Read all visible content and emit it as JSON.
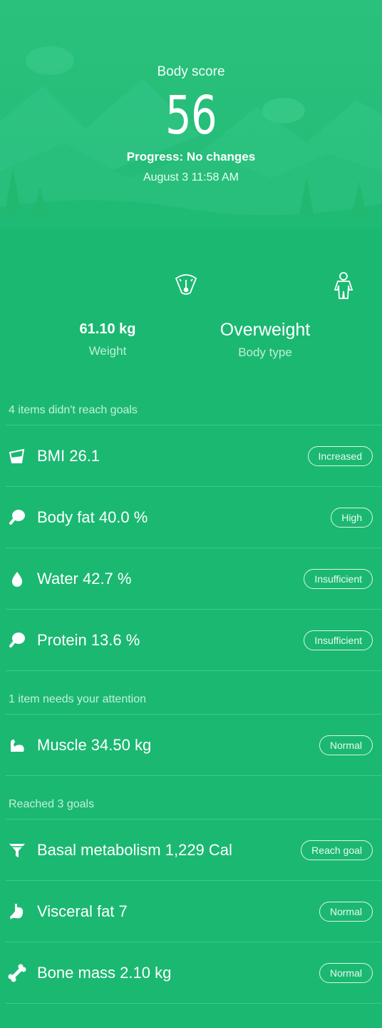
{
  "header": {
    "score_label": "Body score",
    "score_value": "56",
    "progress": "Progress: No changes",
    "date": "August 3 11:58 AM"
  },
  "stats": {
    "weight": {
      "value": "61.10 kg",
      "label": "Weight",
      "icon": "scale-icon"
    },
    "body_type": {
      "value": "Overweight",
      "label": "Body type",
      "icon": "person-icon"
    }
  },
  "sections": [
    {
      "title": "4 items didn't reach goals",
      "items": [
        {
          "label": "BMI 26.1",
          "badge": "Increased",
          "icon": "bmi-icon"
        },
        {
          "label": "Body fat 40.0 %",
          "badge": "High",
          "icon": "drumstick-icon"
        },
        {
          "label": "Water 42.7 %",
          "badge": "Insufficient",
          "icon": "water-drop-icon"
        },
        {
          "label": "Protein 13.6 %",
          "badge": "Insufficient",
          "icon": "drumstick-icon"
        }
      ]
    },
    {
      "title": "1 item needs your attention",
      "items": [
        {
          "label": "Muscle 34.50 kg",
          "badge": "Normal",
          "icon": "muscle-icon"
        }
      ]
    },
    {
      "title": "Reached 3 goals",
      "items": [
        {
          "label": "Basal metabolism 1,229 Cal",
          "badge": "Reach goal",
          "icon": "funnel-icon"
        },
        {
          "label": "Visceral fat 7",
          "badge": "Normal",
          "icon": "stomach-icon"
        },
        {
          "label": "Bone mass 2.10 kg",
          "badge": "Normal",
          "icon": "bone-icon"
        }
      ]
    }
  ],
  "colors": {
    "background": "#1bb872",
    "hero": "#2ac17d",
    "divider": "#3bc98b"
  }
}
